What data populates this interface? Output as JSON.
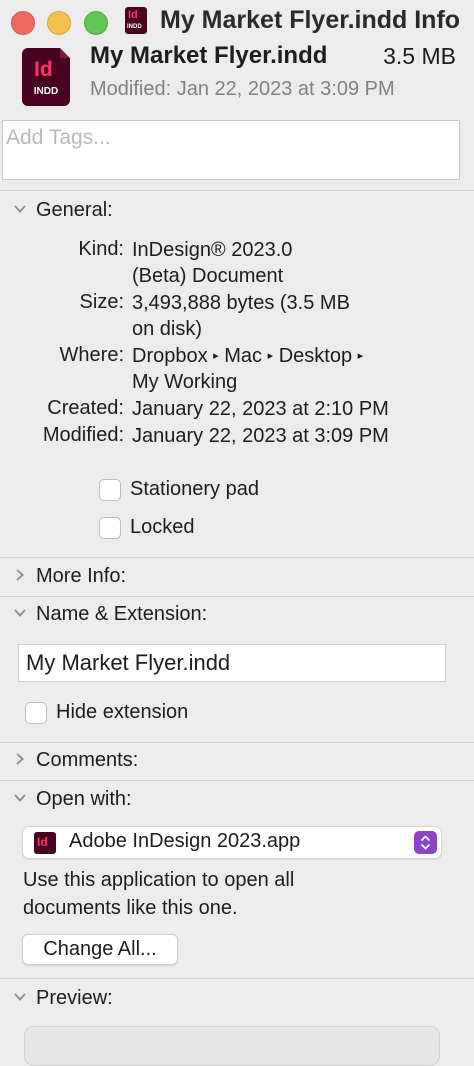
{
  "window": {
    "title": "My Market Flyer.indd Info",
    "icon_label": "Id",
    "icon_sub": "INDD"
  },
  "header": {
    "icon_label": "Id",
    "icon_sub": "INDD",
    "file_name": "My Market Flyer.indd",
    "size": "3.5 MB",
    "modified": "Modified: Jan 22, 2023 at 3:09 PM"
  },
  "tags": {
    "placeholder": "Add Tags..."
  },
  "general": {
    "label": "General:",
    "rows": [
      {
        "key": "Kind:",
        "value": [
          "InDesign® 2023.0",
          "(Beta) Document"
        ]
      },
      {
        "key": "Size:",
        "value": [
          "3,493,888 bytes (3.5 MB",
          "on disk)"
        ]
      },
      {
        "key": "Where:",
        "path": [
          "Dropbox",
          "Mac",
          "Desktop",
          "My Working"
        ]
      },
      {
        "key": "Created:",
        "value": [
          "January 22, 2023 at 2:10 PM"
        ]
      },
      {
        "key": "Modified:",
        "value": [
          "January 22, 2023 at 3:09 PM"
        ]
      }
    ],
    "stationery_pad": {
      "label": "Stationery pad",
      "checked": false
    },
    "locked": {
      "label": "Locked",
      "checked": false
    }
  },
  "more_info": {
    "label": "More Info:"
  },
  "name_extension": {
    "label": "Name & Extension:",
    "value": "My Market Flyer.indd",
    "hide_extension": {
      "label": "Hide extension",
      "checked": false
    }
  },
  "comments": {
    "label": "Comments:"
  },
  "open_with": {
    "label": "Open with:",
    "app_icon_label": "Id",
    "app": "Adobe InDesign 2023.app",
    "note": "Use this application to open all documents like this one.",
    "change_all": "Change All..."
  },
  "preview": {
    "label": "Preview:"
  },
  "colors": {
    "indesign_bg": "#49021f",
    "indesign_fg": "#ff3366",
    "stepper": "#8e44c9",
    "traffic_red": "#ed6a5e",
    "traffic_yellow": "#f5bf4f",
    "traffic_green": "#61c554"
  }
}
